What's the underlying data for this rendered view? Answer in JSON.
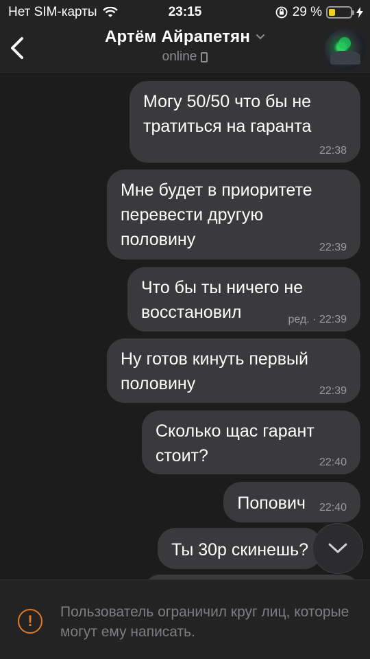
{
  "status_bar": {
    "carrier": "Нет SIM-карты",
    "time": "23:15",
    "battery_percent": "29 %",
    "battery_level": 0.29,
    "battery_color": "#f4d21c",
    "icons": [
      "wifi-icon",
      "orientation-lock-icon",
      "charging-icon"
    ]
  },
  "header": {
    "back_icon": "chevron-left-icon",
    "contact_name": "Артём Айрапетян",
    "presence": "online",
    "device_icon": "mobile-device-icon"
  },
  "messages": [
    {
      "text": "Могу 50/50 что бы не\nтратиться на гаранта",
      "meta": "22:38"
    },
    {
      "text": "Мне будет в приоритете\nперевести другую\nполовину",
      "meta": "22:39"
    },
    {
      "text": "Что бы ты ничего не\nвосстановил",
      "meta": "ред. · 22:39"
    },
    {
      "text": "Ну готов кинуть первый\nполовину",
      "meta": "22:39"
    },
    {
      "text": "Сколько щас гарант\nстоит?",
      "meta": "22:40"
    },
    {
      "text": "Попович",
      "meta": "22:40"
    },
    {
      "text": "Ты 30р скинешь?",
      "meta": ""
    }
  ],
  "footer": {
    "notice": "Пользователь ограничил круг лиц, которые могут ему написать.",
    "warning_color": "#e07b2b"
  }
}
